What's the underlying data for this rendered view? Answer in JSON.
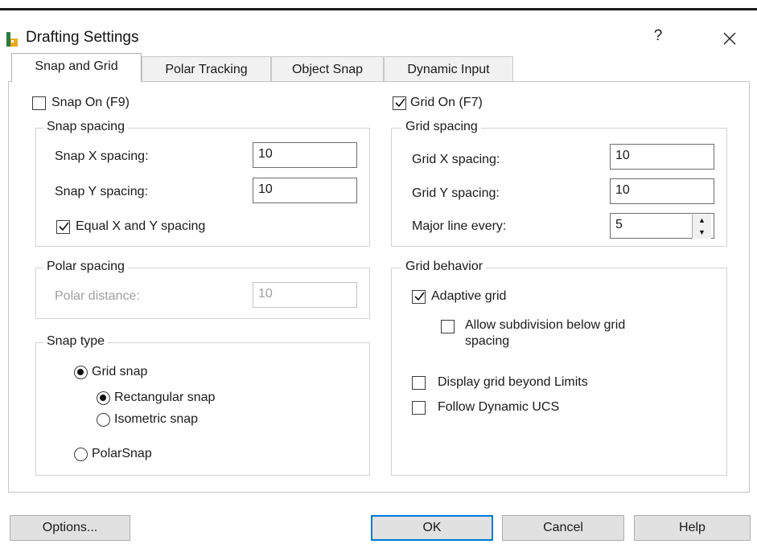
{
  "window": {
    "title": "Drafting Settings",
    "help_label": "?",
    "close_label": "✕"
  },
  "tabs": [
    {
      "label": "Snap and Grid",
      "active": true
    },
    {
      "label": "Polar Tracking",
      "active": false
    },
    {
      "label": "Object Snap",
      "active": false
    },
    {
      "label": "Dynamic Input",
      "active": false
    }
  ],
  "snap_on": {
    "label": "Snap On (F9)",
    "checked": false
  },
  "grid_on": {
    "label": "Grid On (F7)",
    "checked": true
  },
  "snap_spacing": {
    "title": "Snap spacing",
    "x_label": "Snap X spacing:",
    "x_value": "10",
    "y_label": "Snap Y spacing:",
    "y_value": "10",
    "equal_label": "Equal X and Y spacing",
    "equal_checked": true
  },
  "polar_spacing": {
    "title": "Polar spacing",
    "distance_label": "Polar distance:",
    "distance_value": "10",
    "disabled": true
  },
  "snap_type": {
    "title": "Snap type",
    "grid_snap": "Grid snap",
    "rectangular_snap": "Rectangular snap",
    "isometric_snap": "Isometric snap",
    "polar_snap": "PolarSnap",
    "selected_type": "Grid snap",
    "selected_style": "Rectangular snap"
  },
  "grid_spacing": {
    "title": "Grid spacing",
    "x_label": "Grid X spacing:",
    "x_value": "10",
    "y_label": "Grid Y spacing:",
    "y_value": "10",
    "major_label": "Major line every:",
    "major_value": "5"
  },
  "grid_behavior": {
    "title": "Grid behavior",
    "adaptive_label": "Adaptive grid",
    "adaptive_checked": true,
    "subdivision_line1": "Allow subdivision below grid",
    "subdivision_line2": "spacing",
    "subdivision_checked": false,
    "beyond_limits_label": "Display grid beyond Limits",
    "beyond_limits_checked": false,
    "dynamic_ucs_label": "Follow Dynamic UCS",
    "dynamic_ucs_checked": false
  },
  "buttons": {
    "options": "Options...",
    "ok": "OK",
    "cancel": "Cancel",
    "help": "Help"
  },
  "colors": {
    "default_button_border": "#0078d7",
    "disabled_text": "#a0a0a0"
  }
}
